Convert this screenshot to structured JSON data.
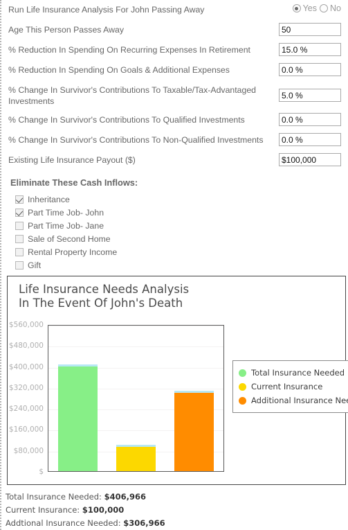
{
  "form": {
    "rows": [
      {
        "label": "Run Life Insurance Analysis For John Passing Away",
        "type": "radio"
      },
      {
        "label": "Age This Person Passes Away",
        "type": "text",
        "value": "50"
      },
      {
        "label": "% Reduction In Spending On Recurring Expenses In Retirement",
        "type": "text",
        "value": "15.0 %"
      },
      {
        "label": "% Reduction In Spending On Goals & Additional Expenses",
        "type": "text",
        "value": "0.0 %"
      },
      {
        "label": "% Change In Survivor's Contributions To Taxable/Tax-Advantaged Investments",
        "type": "text",
        "value": "5.0 %"
      },
      {
        "label": "% Change In Survivor's Contributions To Qualified Investments",
        "type": "text",
        "value": "0.0 %"
      },
      {
        "label": "% Change In Survivor's Contributions To Non-Qualified Investments",
        "type": "text",
        "value": "0.0 %"
      },
      {
        "label": "Existing Life Insurance Payout ($)",
        "type": "text",
        "value": "$100,000"
      }
    ],
    "radio": {
      "yes_label": "Yes",
      "no_label": "No",
      "selected": "Yes"
    }
  },
  "cash_inflows": {
    "title": "Eliminate These Cash Inflows:",
    "items": [
      {
        "label": "Inheritance",
        "checked": true
      },
      {
        "label": "Part Time Job- John",
        "checked": true
      },
      {
        "label": "Part Time Job- Jane",
        "checked": false
      },
      {
        "label": "Sale of Second Home",
        "checked": false
      },
      {
        "label": "Rental Property Income",
        "checked": false
      },
      {
        "label": "Gift",
        "checked": false
      }
    ]
  },
  "chart_data": {
    "type": "bar",
    "title": "Life Insurance Needs Analysis\nIn The Event Of John's Death",
    "xlabel": "",
    "ylabel": "",
    "grid": true,
    "legend_position": "right",
    "ylim": [
      0,
      560000
    ],
    "ytick_labels": [
      "$560,000",
      "$480,000",
      "$400,000",
      "$320,000",
      "$240,000",
      "$160,000",
      "$80,000",
      "$"
    ],
    "ytick_values": [
      560000,
      480000,
      400000,
      320000,
      240000,
      160000,
      80000,
      0
    ],
    "categories": [
      "Total Insurance Needed",
      "Current Insurance",
      "Additional Insurance Needed"
    ],
    "values": [
      406966,
      100000,
      306966
    ],
    "colors": [
      "#87EF87",
      "#FCD800",
      "#FF8C00"
    ],
    "bar_top_border_color": "#B7E8F5",
    "legend": [
      {
        "label": "Total Insurance Needed",
        "color": "#87EF87"
      },
      {
        "label": "Current Insurance",
        "color": "#FCD800"
      },
      {
        "label": "Additional Insurance Needed",
        "color": "#FF8C00"
      }
    ]
  },
  "summary": {
    "rows": [
      {
        "label": "Total Insurance Needed:",
        "value": "$406,966"
      },
      {
        "label": "Current Insurance:",
        "value": "$100,000"
      },
      {
        "label": "Addtional Insurance Needed:",
        "value": "$306,966"
      }
    ]
  }
}
